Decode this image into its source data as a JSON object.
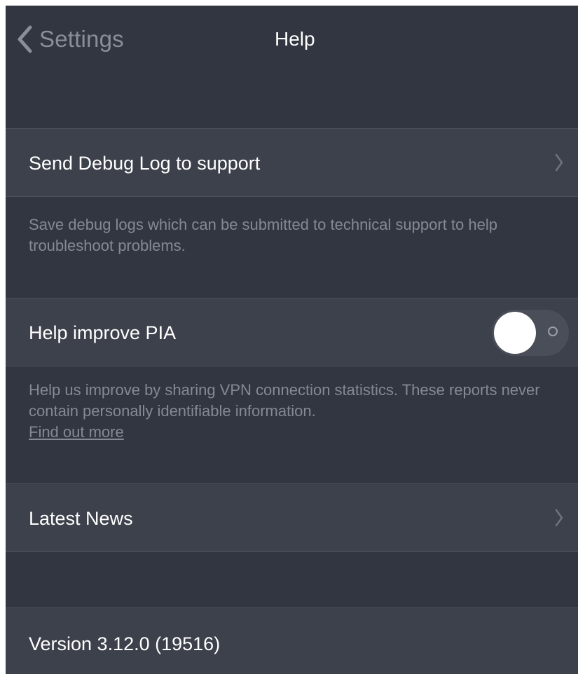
{
  "navbar": {
    "back_label": "Settings",
    "title": "Help"
  },
  "debug_log": {
    "label": "Send Debug Log to support",
    "description": "Save debug logs which can be submitted to technical support to help troubleshoot problems."
  },
  "help_improve": {
    "label": "Help improve PIA",
    "toggle_on": false,
    "description": "Help us improve by sharing VPN connection statistics. These reports never contain personally identifiable information.",
    "link_text": "Find out more"
  },
  "latest_news": {
    "label": "Latest News"
  },
  "version": {
    "label": "Version 3.12.0 (19516)"
  },
  "colors": {
    "background": "#323640",
    "row_background": "#3d414b",
    "secondary_text": "#858993"
  },
  "icons": {
    "back": "chevron-left-icon",
    "disclosure": "chevron-right-icon"
  }
}
